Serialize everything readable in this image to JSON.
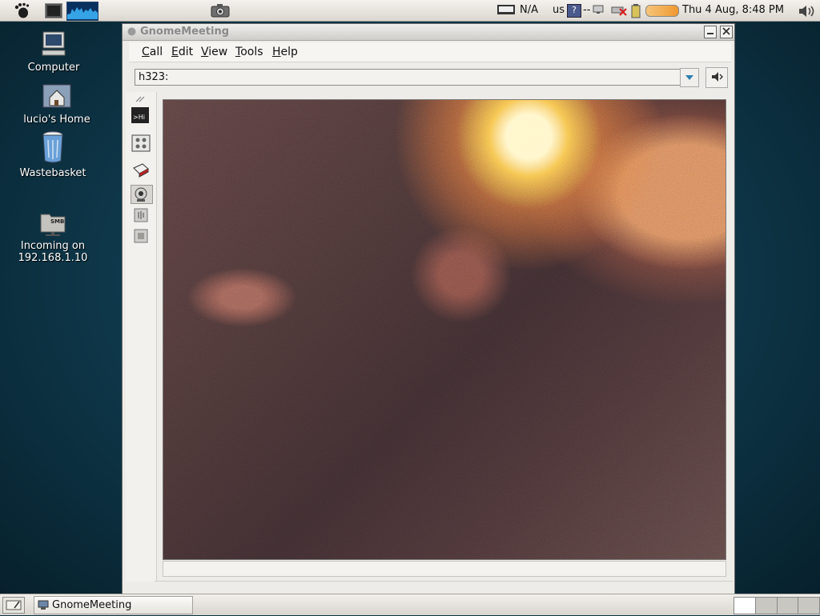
{
  "top_panel": {
    "keyboard_status": "N/A",
    "keyboard_layout": "us",
    "help_mark": "?",
    "net_status": "--",
    "clock": "Thu  4 Aug,  8:48 PM"
  },
  "desktop_icons": [
    {
      "label": "Computer"
    },
    {
      "label": "lucio's Home"
    },
    {
      "label": "Wastebasket"
    },
    {
      "label_line1": "Incoming on",
      "label_line2": "192.168.1.10",
      "badge": "SMB"
    }
  ],
  "window": {
    "title": "GnomeMeeting",
    "menu": [
      {
        "mnemonic": "C",
        "rest": "all"
      },
      {
        "mnemonic": "E",
        "rest": "dit"
      },
      {
        "mnemonic": "V",
        "rest": "iew"
      },
      {
        "mnemonic": "T",
        "rest": "ools"
      },
      {
        "mnemonic": "H",
        "rest": "elp"
      }
    ],
    "address_value": "h323:",
    "side_tools": {
      "text_chat_label": ">Hi"
    }
  },
  "bottom_panel": {
    "task_gm_label": "GnomeMeeting",
    "workspaces": 4,
    "active_workspace": 1
  },
  "colors": {
    "desktop_bg": "#0f3b4e",
    "panel_bg": "#dcd8d0",
    "accent_blue": "#2e7fb3"
  }
}
